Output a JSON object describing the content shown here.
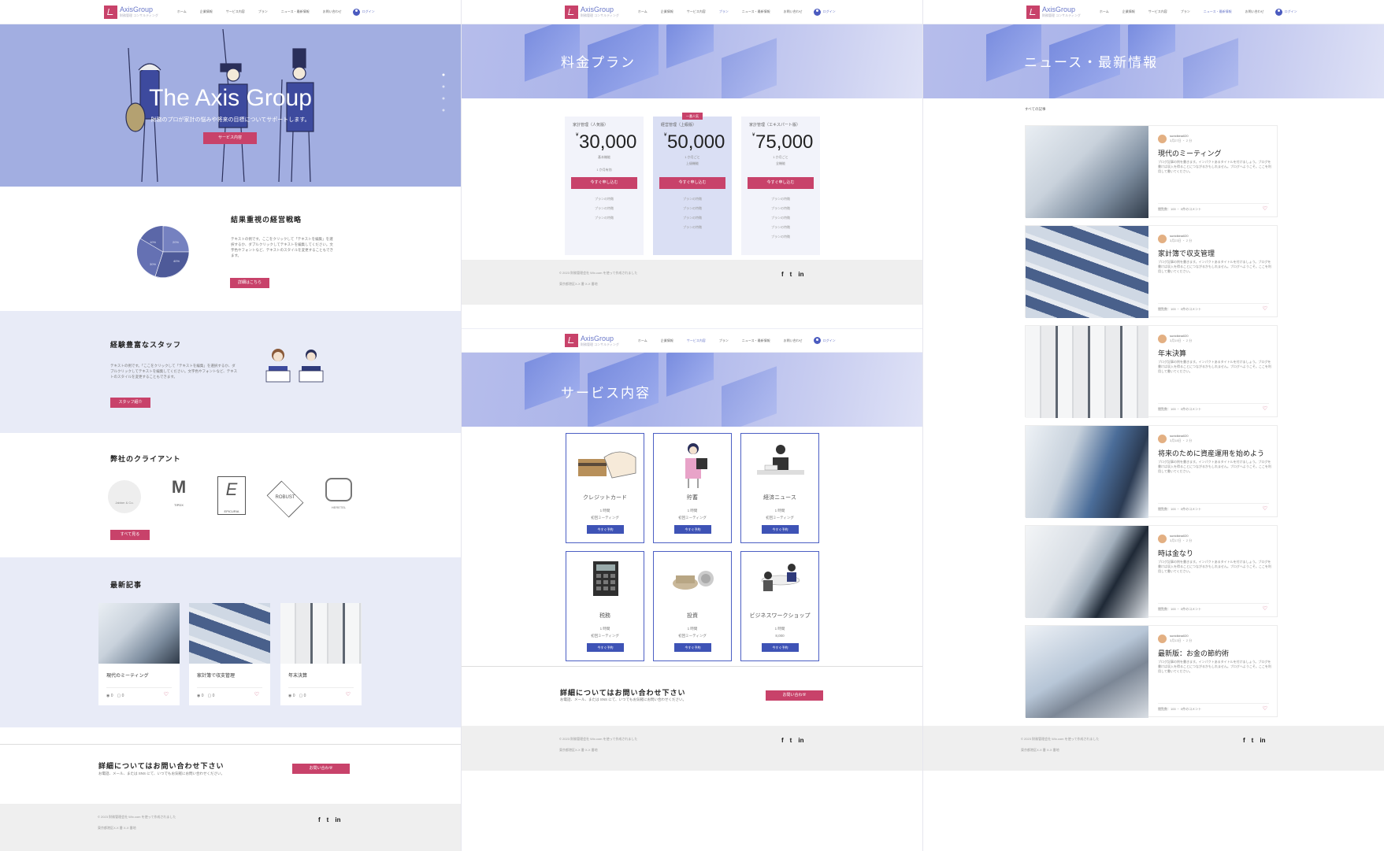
{
  "header": {
    "brand": "AxisGroup",
    "brand_sub": "財務管理 コンサルティング",
    "nav": [
      "ホーム",
      "企業情報",
      "サービス内容",
      "プラン",
      "ニュース・最新情報",
      "お問い合わせ"
    ],
    "login": "ログイン"
  },
  "home": {
    "hero_title": "The Axis Group",
    "hero_subtitle": "財務のプロが家計の悩みや将来の目標についてサポートします。",
    "hero_button": "サービス内容",
    "strategy_title": "結果重視の経営戦略",
    "strategy_text": "テキストの例です。ここをクリックして「テキストを編集」を選択するか、ダブルクリックしてテキストを編集してください。文字色やフォントなど、テキストのスタイルを変更することもできます。",
    "strategy_button": "詳細はこちら",
    "pie_labels": [
      "20%",
      "40%",
      "30%",
      "10%"
    ],
    "staff_title": "経験豊富なスタッフ",
    "staff_text": "テキストの例です。「ここをクリックして「テキストを編集」を選択するか、ダブルクリックしてテキストを編集してください。文字色やフォントなど、テキストのスタイルを変更することもできます。",
    "staff_button": "スタッフ紹介",
    "clients_title": "弊社のクライアント",
    "clients": [
      "Jabber & Co.",
      "TIPDX",
      "EPICURIA",
      "ROBUST",
      "HERETEL"
    ],
    "clients_button": "すべて見る",
    "recent_title": "最新記事",
    "recent_posts": [
      {
        "title": "現代のミーティング",
        "views": "0",
        "comments": "0"
      },
      {
        "title": "家計簿で収支管理",
        "views": "0",
        "comments": "0"
      },
      {
        "title": "年末決算",
        "views": "0",
        "comments": "0"
      }
    ],
    "contact_title": "詳細についてはお問い合わせ下さい",
    "contact_text": "お電話、メール、または SNS にて、いつでもお気軽にお問い合わせください。",
    "contact_button": "お問い合わせ"
  },
  "footer": {
    "copyright": "© 2023 財務管理会社 Wix.com を使って作成されました",
    "address": "東京都港区X-X 番 X-X 番地",
    "social": [
      "f",
      "t",
      "in"
    ]
  },
  "plans_page": {
    "banner_title": "料金プラン",
    "popular_badge": "一番人気",
    "plans": [
      {
        "name": "家計管理（人気版）",
        "price": "30,000",
        "currency": "¥",
        "sub1": "基本機能",
        "sub2": "1 か月有効",
        "button": "今すぐ申し込む",
        "features": [
          "プランの特徴",
          "プランの特徴",
          "プランの特徴"
        ]
      },
      {
        "name": "経営管理（上級版）",
        "price": "50,000",
        "currency": "¥",
        "sub1": "上級機能",
        "sub2": "1 か月ごと",
        "button": "今すぐ申し込む",
        "features": [
          "プランの特徴",
          "プランの特徴",
          "プランの特徴",
          "プランの特徴"
        ]
      },
      {
        "name": "家計管理（エキスパート版）",
        "price": "75,000",
        "currency": "¥",
        "sub1": "全機能",
        "sub2": "1 か月ごと",
        "button": "今すぐ申し込む",
        "features": [
          "プランの特徴",
          "プランの特徴",
          "プランの特徴",
          "プランの特徴",
          "プランの特徴"
        ]
      }
    ]
  },
  "services_page": {
    "banner_title": "サービス内容",
    "services": [
      {
        "name": "クレジットカード",
        "line1": "1 時間",
        "line2": "初回ミーティング",
        "button": "今すぐ予約"
      },
      {
        "name": "貯蓄",
        "line1": "1 時間",
        "line2": "初回ミーティング",
        "button": "今すぐ予約"
      },
      {
        "name": "経済ニュース",
        "line1": "1 時間",
        "line2": "初回ミーティング",
        "button": "今すぐ予約"
      },
      {
        "name": "税務",
        "line1": "1 時間",
        "line2": "初回ミーティング",
        "button": "今すぐ予約"
      },
      {
        "name": "投資",
        "line1": "1 時間",
        "line2": "初回ミーティング",
        "button": "今すぐ予約"
      },
      {
        "name": "ビジネスワークショップ",
        "line1": "1 時間",
        "line2": "8,000",
        "button": "今すぐ予約"
      }
    ],
    "contact_title": "詳細についてはお問い合わせ下さい",
    "contact_text": "お電話、メール、または SNS にて、いつでもお気軽にお問い合わせください。",
    "contact_button": "お問い合わせ"
  },
  "news_page": {
    "banner_title": "ニュース・最新情報",
    "filter": "すべての記事",
    "posts": [
      {
        "title": "現代のミーティング",
        "author": "sunidkina020",
        "date": "3月27日 ・ 2 分",
        "excerpt": "ブログ記事の例を書きます。インパクトあるタイトルを付けましょう。ブログを書けば収入を得ることにつながるかもしれません。ブログへようこそ。ここを利用して書いてください。",
        "stats": "閲覧数：100 ・ 0件のコメント"
      },
      {
        "title": "家計簿で収支管理",
        "author": "sunidkina020",
        "date": "3月23日 ・ 2 分",
        "excerpt": "ブログ記事の例を書きます。インパクトあるタイトルを付けましょう。ブログを書けば収入を得ることにつながるかもしれません。ブログへようこそ。ここを利用して書いてください。",
        "stats": "閲覧数：100 ・ 0件のコメント"
      },
      {
        "title": "年末決算",
        "author": "sunidkina020",
        "date": "3月19日 ・ 2 分",
        "excerpt": "ブログ記事の例を書きます。インパクトあるタイトルを付けましょう。ブログを書けば収入を得ることにつながるかもしれません。ブログへようこそ。ここを利用して書いてください。",
        "stats": "閲覧数：100 ・ 0件のコメント"
      },
      {
        "title": "将来のために資産運用を始めよう",
        "author": "sunidkina020",
        "date": "3月18日 ・ 2 分",
        "excerpt": "ブログ記事の例を書きます。インパクトあるタイトルを付けましょう。ブログを書けば収入を得ることにつながるかもしれません。ブログへようこそ。ここを利用して書いてください。",
        "stats": "閲覧数：100 ・ 0件のコメント"
      },
      {
        "title": "時は金なり",
        "author": "sunidkina020",
        "date": "3月17日 ・ 2 分",
        "excerpt": "ブログ記事の例を書きます。インパクトあるタイトルを付けましょう。ブログを書けば収入を得ることにつながるかもしれません。ブログへようこそ。ここを利用して書いてください。",
        "stats": "閲覧数：100 ・ 0件のコメント"
      },
      {
        "title": "最新版：お金の節約術",
        "author": "sunidkina020",
        "date": "3月13日 ・ 2 分",
        "excerpt": "ブログ記事の例を書きます。インパクトあるタイトルを付けましょう。ブログを書けば収入を得ることにつながるかもしれません。ブログへようこそ。ここを利用して書いてください。",
        "stats": "閲覧数：100 ・ 0件のコメント"
      }
    ]
  },
  "colors": {
    "accent": "#c8426a",
    "brand_blue": "#4b5bbf",
    "hero": "#a2aee1",
    "light_section": "#e8ebf7"
  }
}
